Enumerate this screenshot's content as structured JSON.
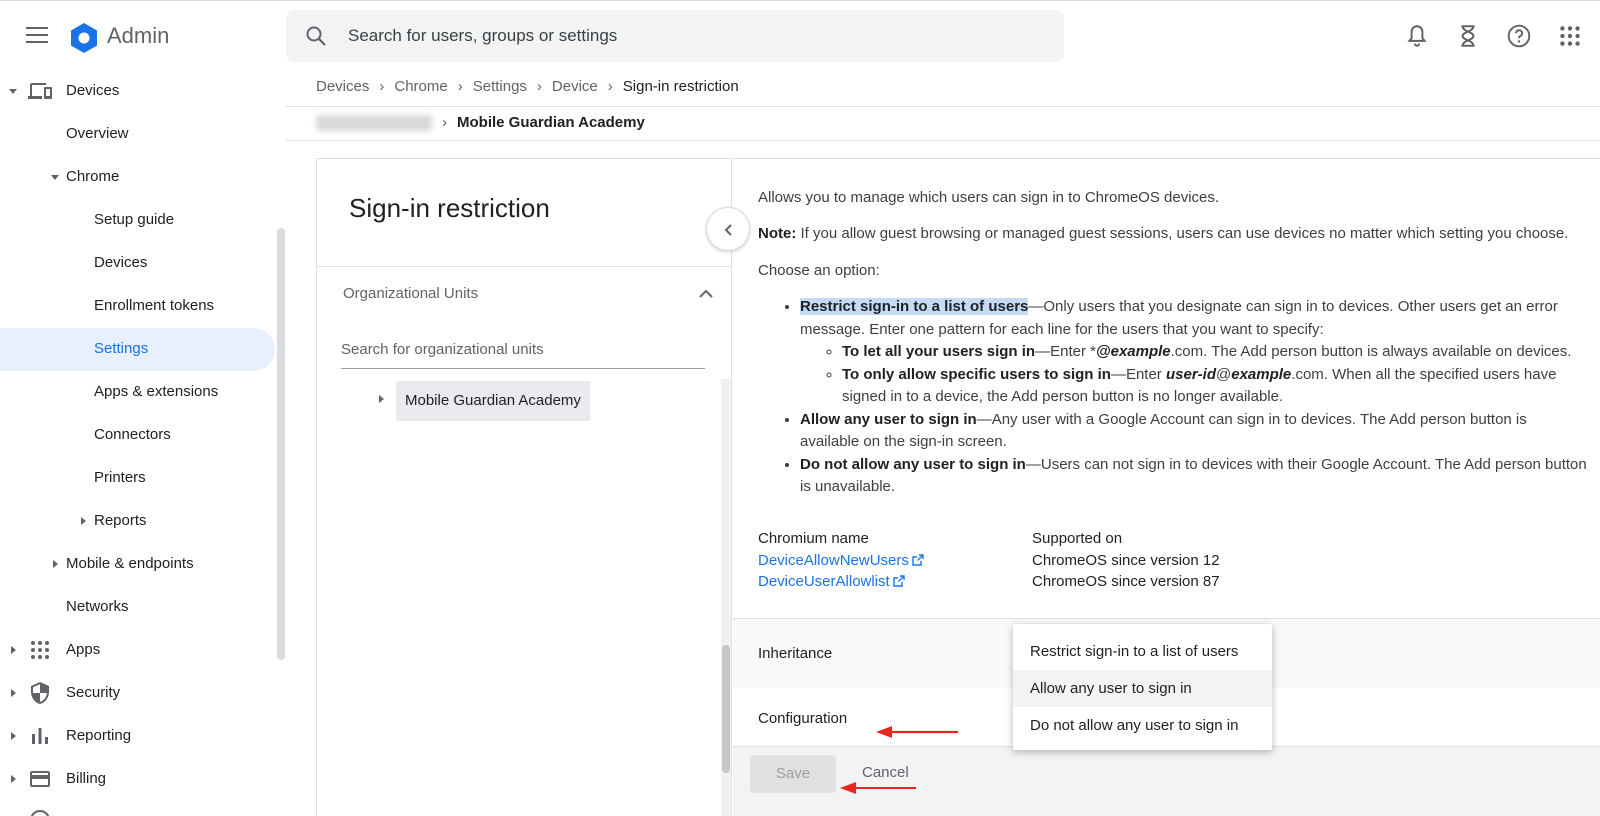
{
  "header": {
    "app_title": "Admin",
    "search_placeholder": "Search for users, groups or settings"
  },
  "sidebar": {
    "items": [
      {
        "label": "Devices",
        "icon": "devices-icon"
      },
      {
        "label": "Overview"
      },
      {
        "label": "Chrome"
      },
      {
        "label": "Setup guide"
      },
      {
        "label": "Devices"
      },
      {
        "label": "Enrollment tokens"
      },
      {
        "label": "Settings"
      },
      {
        "label": "Apps & extensions"
      },
      {
        "label": "Connectors"
      },
      {
        "label": "Printers"
      },
      {
        "label": "Reports"
      },
      {
        "label": "Mobile & endpoints"
      },
      {
        "label": "Networks"
      },
      {
        "label": "Apps",
        "icon": "apps-grid-icon"
      },
      {
        "label": "Security",
        "icon": "shield-icon"
      },
      {
        "label": "Reporting",
        "icon": "bar-chart-icon"
      },
      {
        "label": "Billing",
        "icon": "credit-card-icon"
      }
    ]
  },
  "breadcrumb": [
    "Devices",
    "Chrome",
    "Settings",
    "Device",
    "Sign-in restriction"
  ],
  "org_breadcrumb": {
    "current": "Mobile Guardian Academy"
  },
  "left_panel": {
    "title": "Sign-in restriction",
    "ou_header": "Organizational Units",
    "ou_search_placeholder": "Search for organizational units",
    "ou_item": "Mobile Guardian Academy"
  },
  "content": {
    "intro": "Allows you to manage which users can sign in to ChromeOS devices.",
    "note_label": "Note:",
    "note_text": " If you allow guest browsing or managed guest sessions, users can use devices no matter which setting you choose.",
    "choose": "Choose an option:",
    "opt1_title": "Restrict sign-in to a list of users",
    "opt1_text": "—Only users that you designate can sign in to devices. Other users get an error message. Enter one pattern for each line for the users that you want to specify:",
    "sub1_title": "To let all your users sign in",
    "sub1_a": "—Enter *",
    "sub1_b": "@example",
    "sub1_c": ".com. The Add person button is always available on devices.",
    "sub2_title": "To only allow specific users to sign in",
    "sub2_a": "—Enter ",
    "sub2_b": "user-id",
    "sub2_c": "@",
    "sub2_d": "example",
    "sub2_e": ".com. When all the specified users have signed in to a device, the Add person button is no longer available.",
    "opt2_title": "Allow any user to sign in",
    "opt2_text": "—Any user with a Google Account can sign in to devices. The Add person button is available on the sign-in screen.",
    "opt3_title": "Do not allow any user to sign in",
    "opt3_text": "—Users can not sign in to devices with their Google Account. The Add person button is unavailable.",
    "chromium_name_header": "Chromium name",
    "supported_header": "Supported on",
    "policies": [
      {
        "name": "DeviceAllowNewUsers",
        "supported": "ChromeOS since version 12"
      },
      {
        "name": "DeviceUserAllowlist",
        "supported": "ChromeOS since version 87"
      }
    ],
    "inheritance_label": "Inheritance",
    "configuration_label": "Configuration",
    "save_label": "Save",
    "cancel_label": "Cancel"
  },
  "dropdown": {
    "options": [
      "Restrict sign-in to a list of users",
      "Allow any user to sign in",
      "Do not allow any user to sign in"
    ],
    "highlighted": "Allow any user to sign in"
  },
  "colors": {
    "accent": "#1a73e8",
    "annotation_arrow": "#e8281d",
    "highlight": "#c5dbf5"
  }
}
